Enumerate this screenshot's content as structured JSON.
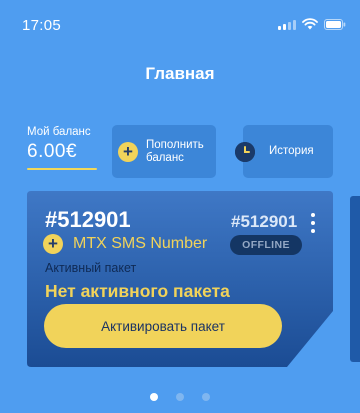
{
  "status_bar": {
    "time": "17:05",
    "icons": [
      "signal-icon",
      "wifi-icon",
      "battery-icon"
    ]
  },
  "page": {
    "title": "Главная"
  },
  "balance": {
    "label": "Мой баланс",
    "value": "6.00€"
  },
  "actions": {
    "topup_line1": "Пополнить",
    "topup_line2": "баланс",
    "history": "История"
  },
  "card": {
    "id_main": "#512901",
    "id_secondary": "#512901",
    "product_name": "MTX SMS Number",
    "status": "OFFLINE",
    "package_label": "Активный пакет",
    "package_value": "Нет активного пакета",
    "activate_label": "Активировать пакет"
  },
  "pager": {
    "total": 3,
    "active": 1
  },
  "colors": {
    "background": "#4f9df0",
    "accent_yellow": "#f1d35a",
    "card_gradient_top": "#3f78c6",
    "card_gradient_bottom": "#1b4c94",
    "badge_bg": "#143664"
  }
}
